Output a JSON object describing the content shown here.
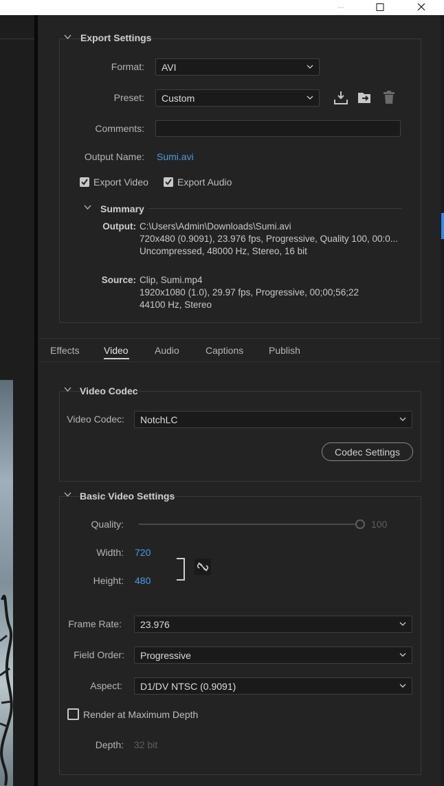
{
  "window": {
    "minimize_icon": "minimize-icon",
    "maximize_icon": "maximize-icon",
    "close_icon": "close-icon"
  },
  "export_settings": {
    "title": "Export Settings",
    "format_label": "Format:",
    "format_value": "AVI",
    "preset_label": "Preset:",
    "preset_value": "Custom",
    "comments_label": "Comments:",
    "comments_value": "",
    "output_name_label": "Output Name:",
    "output_name_value": "Sumi.avi",
    "export_video_label": "Export Video",
    "export_video_checked": true,
    "export_audio_label": "Export Audio",
    "export_audio_checked": true
  },
  "summary": {
    "title": "Summary",
    "output_label": "Output:",
    "output_lines": [
      "C:\\Users\\Admin\\Downloads\\Sumi.avi",
      "720x480 (0.9091), 23.976 fps, Progressive, Quality 100, 00:0...",
      "Uncompressed, 48000 Hz, Stereo, 16 bit"
    ],
    "source_label": "Source:",
    "source_lines": [
      "Clip, Sumi.mp4",
      "1920x1080 (1.0), 29.97 fps, Progressive, 00;00;56;22",
      "44100 Hz, Stereo"
    ]
  },
  "tabs": [
    {
      "label": "Effects",
      "active": false
    },
    {
      "label": "Video",
      "active": true
    },
    {
      "label": "Audio",
      "active": false
    },
    {
      "label": "Captions",
      "active": false
    },
    {
      "label": "Publish",
      "active": false
    }
  ],
  "video_codec": {
    "title": "Video Codec",
    "codec_label": "Video Codec:",
    "codec_value": "NotchLC",
    "settings_button": "Codec Settings"
  },
  "basic_video": {
    "title": "Basic Video Settings",
    "quality_label": "Quality:",
    "quality_value": "100",
    "quality_level": 1.0,
    "width_label": "Width:",
    "width_value": "720",
    "height_label": "Height:",
    "height_value": "480",
    "frame_rate_label": "Frame Rate:",
    "frame_rate_value": "23.976",
    "field_order_label": "Field Order:",
    "field_order_value": "Progressive",
    "aspect_label": "Aspect:",
    "aspect_value": "D1/DV NTSC (0.9091)",
    "render_max_depth_label": "Render at Maximum Depth",
    "render_max_depth_checked": false,
    "depth_label": "Depth:",
    "depth_value": "32 bit"
  },
  "colors": {
    "accent": "#4a9be8",
    "panel_bg": "#232323",
    "field_bg": "#1a1a1a"
  }
}
